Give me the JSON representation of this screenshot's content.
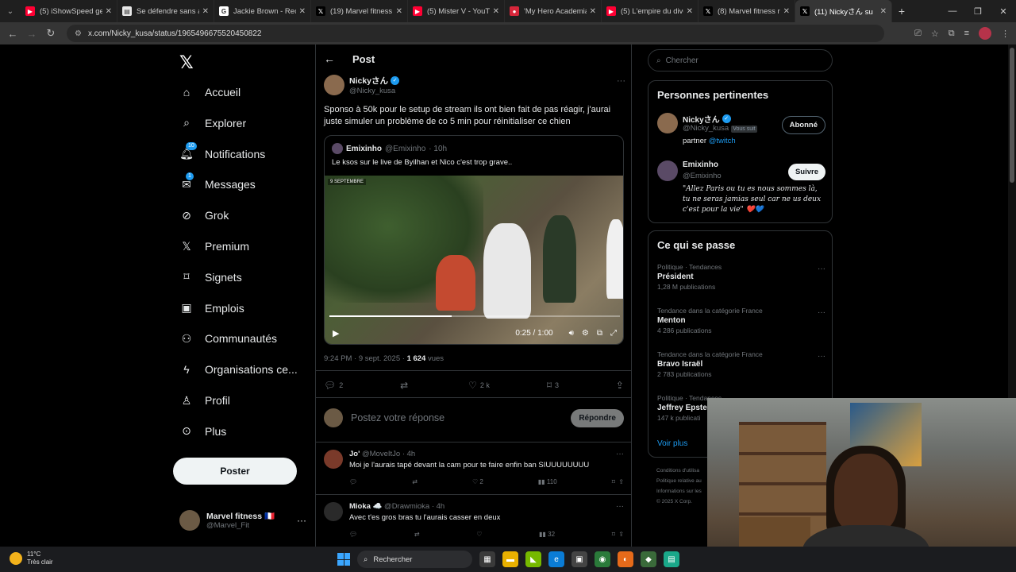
{
  "browser": {
    "tabs": [
      {
        "title": "(5) iShowSpeed gets",
        "fav": "▶",
        "fav_color": "#ff0033"
      },
      {
        "title": "Se défendre sans avo",
        "fav": "▤",
        "fav_color": "#e8e8e8"
      },
      {
        "title": "Jackie Brown - Reche",
        "fav": "G",
        "fav_color": "#ffffff"
      },
      {
        "title": "(19) Marvel fitness r",
        "fav": "𝕏",
        "fav_color": "#000000"
      },
      {
        "title": "(5) Mister V - YouTu",
        "fav": "▶",
        "fav_color": "#ff0033"
      },
      {
        "title": "'My Hero Academia'",
        "fav": "●",
        "fav_color": "#d6263a"
      },
      {
        "title": "(5) L'empire du diver",
        "fav": "▶",
        "fav_color": "#ff0033"
      },
      {
        "title": "(8) Marvel fitness r",
        "fav": "𝕏",
        "fav_color": "#000000"
      },
      {
        "title": "(11) Nickyさん su",
        "fav": "𝕏",
        "fav_color": "#000000",
        "active": true
      }
    ],
    "url": "x.com/Nicky_kusa/status/1965496675520450822"
  },
  "nav": {
    "logo": "𝕏",
    "items": [
      {
        "label": "Accueil",
        "icon": "home-icon",
        "glyph": "⌂"
      },
      {
        "label": "Explorer",
        "icon": "search-icon",
        "glyph": "⌕"
      },
      {
        "label": "Notifications",
        "icon": "bell-icon",
        "glyph": "🔔︎",
        "badge": "10"
      },
      {
        "label": "Messages",
        "icon": "mail-icon",
        "glyph": "✉",
        "badge": "1"
      },
      {
        "label": "Grok",
        "icon": "grok-icon",
        "glyph": "⊘"
      },
      {
        "label": "Premium",
        "icon": "x-premium-icon",
        "glyph": "𝕏"
      },
      {
        "label": "Signets",
        "icon": "bookmark-icon",
        "glyph": "⌑"
      },
      {
        "label": "Emplois",
        "icon": "briefcase-icon",
        "glyph": "▣"
      },
      {
        "label": "Communautés",
        "icon": "people-icon",
        "glyph": "⚇"
      },
      {
        "label": "Organisations ce...",
        "icon": "lightning-icon",
        "glyph": "ϟ"
      },
      {
        "label": "Profil",
        "icon": "person-icon",
        "glyph": "♙"
      },
      {
        "label": "Plus",
        "icon": "more-circle-icon",
        "glyph": "⊙"
      }
    ],
    "post_button": "Poster",
    "account": {
      "name": "Marvel fitness 🇫🇷",
      "handle": "@Marvel_Fit"
    }
  },
  "post": {
    "header": "Post",
    "author": {
      "name": "Nickyさん",
      "handle": "@Nicky_kusa"
    },
    "text": "Sponso à 50k pour le setup de stream ils ont bien fait de pas réagir, j'aurai juste simuler un problème de co 5 min pour réinitialiser ce chien",
    "quote": {
      "name": "Emixinho",
      "handle": "@Emixinho",
      "time": "· 10h",
      "text": "Le ksos sur le live de Byilhan et Nico c'est trop grave..",
      "video_label": "9 SEPTEMBRE",
      "video_time": "0:25 / 1:00",
      "progress": 0.42
    },
    "meta_time": "9:24 PM · 9 sept. 2025 · ",
    "meta_views": "1 624",
    "meta_views_label": " vues",
    "stats": {
      "replies": "2",
      "reposts": "",
      "likes": "2 k",
      "bookmarks": "3"
    }
  },
  "reply_box": {
    "placeholder": "Postez votre réponse",
    "button": "Répondre"
  },
  "replies": [
    {
      "name": "Jo'",
      "handle": "@MoveItJo · 4h",
      "text": "Moi je l'aurais tapé devant la cam pour te faire enfin ban SIUUUUUUUU",
      "likes": "2",
      "views": "110",
      "avatar_color": "#7a3a2a"
    },
    {
      "name": "Mioka ☁️",
      "handle": "@Drawmioka · 4h",
      "text": "Avec t'es gros bras tu l'aurais casser en deux",
      "likes": "",
      "views": "32",
      "avatar_color": "#2a2a2a"
    }
  ],
  "right": {
    "search_placeholder": "Chercher",
    "people_title": "Personnes pertinentes",
    "people": [
      {
        "name": "Nickyさん",
        "handle": "@Nicky_kusa",
        "follows_you": "Vous suit",
        "button": "Abonné",
        "bio_prefix": "partner ",
        "bio_link": "@twitch"
      },
      {
        "name": "Emixinho",
        "handle": "@Emixinho",
        "button": "Suivre",
        "bio": "\"Allez Paris ou tu es nous sommes là, tu ne seras jamias seul car ne us deux c'est pour la vie\" ❤️💙"
      }
    ],
    "trends_title": "Ce qui se passe",
    "trends": [
      {
        "category": "Politique · Tendances",
        "name": "Président",
        "posts": "1,28 M publications"
      },
      {
        "category": "Tendance dans la catégorie France",
        "name": "Menton",
        "posts": "4 286 publications"
      },
      {
        "category": "Tendance dans la catégorie France",
        "name": "Bravo Israël",
        "posts": "2 783 publications"
      },
      {
        "category": "Politique · Tendances",
        "name": "Jeffrey Epstei",
        "posts": "147 k publicati"
      }
    ],
    "show_more": "Voir plus",
    "footer": [
      "Conditions d'utilisa",
      "Politique relative au",
      "Informations sur les",
      "© 2025 X Corp."
    ]
  },
  "taskbar": {
    "temp": "11°C",
    "weather": "Très clair",
    "search": "Rechercher"
  }
}
